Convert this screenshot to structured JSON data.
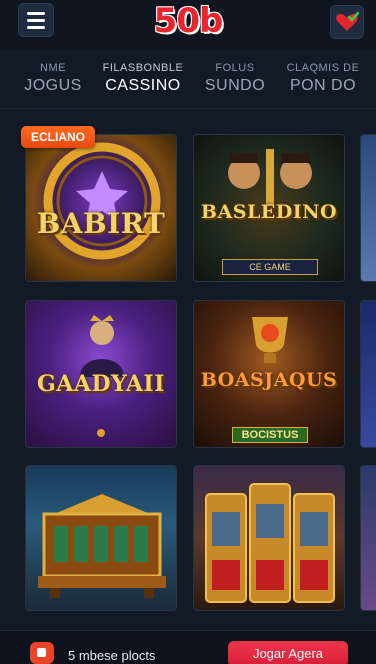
{
  "header": {
    "logo": "50b",
    "menu_icon": "hamburger-icon",
    "fav_icon": "heart-check-icon"
  },
  "tabs": [
    {
      "sub": "NME",
      "main": "JOGUS",
      "active": false
    },
    {
      "sub": "FILASBONBLE",
      "main": "CASSINO",
      "active": true
    },
    {
      "sub": "FOLUS",
      "main": "SUNDO",
      "active": false
    },
    {
      "sub": "CLAQMIS DE",
      "main": "PON DO",
      "active": false
    }
  ],
  "badge": "ECLIANO",
  "games": [
    {
      "title": "BABIRT",
      "subtitle": ""
    },
    {
      "title": "BASLEDINO",
      "subtitle": "CE GAME"
    },
    {
      "title": "GAADYAII",
      "subtitle": ""
    },
    {
      "title": "BOASJAQUS",
      "subtitle": "BOCISTUS"
    },
    {
      "title": "",
      "subtitle": ""
    },
    {
      "title": "",
      "subtitle": ""
    }
  ],
  "bottom": {
    "players_text": "5 mbese plocts",
    "play_label": "Jogar Agera"
  },
  "colors": {
    "accent_red": "#e8242e",
    "badge_orange": "#ff6a1f",
    "background": "#121a26"
  }
}
